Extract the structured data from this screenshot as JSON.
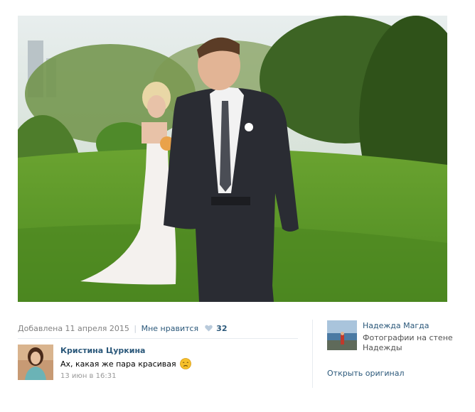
{
  "photo": {
    "alt_subject": "groom-and-bride-photo"
  },
  "meta": {
    "added_label": "Добавлена 11 апреля 2015",
    "separator": "|",
    "like_label": "Мне нравится",
    "likes_count": "32"
  },
  "comment": {
    "author": "Кристина Цуркина",
    "text": "Ах, какая же пара красивая",
    "time": "13 июн в 16:31"
  },
  "owner": {
    "name": "Надежда Магда",
    "album_line1": "Фотографии на стене",
    "album_line2": "Надежды"
  },
  "actions": {
    "open_original": "Открыть оригинал"
  },
  "colors": {
    "link": "#2b587a",
    "muted": "#828282",
    "divider": "#e7ebf0"
  }
}
